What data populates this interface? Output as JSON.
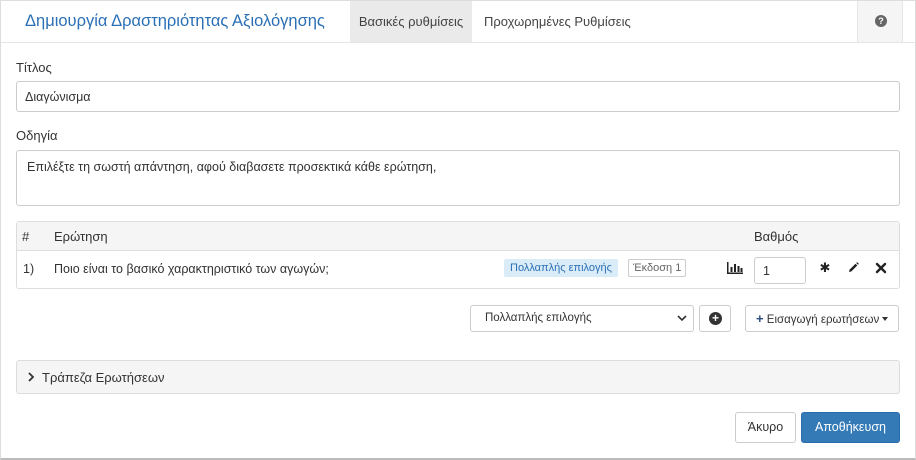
{
  "header": {
    "title": "Δημιουργία Δραστηριότητας Αξιολόγησης",
    "tabs": [
      {
        "label": "Βασικές ρυθμίσεις",
        "active": true
      },
      {
        "label": "Προχωρημένες Ρυθμίσεις",
        "active": false
      }
    ],
    "help_icon": "question-circle-icon"
  },
  "form": {
    "title_label": "Τίτλος",
    "title_value": "Διαγώνισμα",
    "instructions_label": "Οδηγία",
    "instructions_value": "Επιλέξτε τη σωστή απάντηση, αφού διαβασετε προσεκτικά κάθε ερώτηση,"
  },
  "questions_table": {
    "headers": {
      "num": "#",
      "question": "Ερώτηση",
      "score": "Βαθμός"
    },
    "rows": [
      {
        "num": "1)",
        "question": "Ποιο είναι το βασικό χαρακτηριστικό των αγωγών;",
        "type_badge": "Πολλαπλής επιλογής",
        "version_badge": "Έκδοση 1",
        "score": "1",
        "icons": [
          "bar-chart-icon",
          "asterisk-icon",
          "pencil-icon",
          "times-icon"
        ]
      }
    ]
  },
  "toolbar": {
    "question_type_selected": "Πολλαπλής επιλογής",
    "import_label": "Εισαγωγή ερωτήσεων"
  },
  "question_bank": {
    "label": "Τράπεζα Ερωτήσεων"
  },
  "footer": {
    "cancel_label": "Άκυρο",
    "save_label": "Αποθήκευση"
  },
  "colors": {
    "accent": "#337ab7",
    "title": "#2a6fb6",
    "badge_bg": "#d9ecf8"
  }
}
